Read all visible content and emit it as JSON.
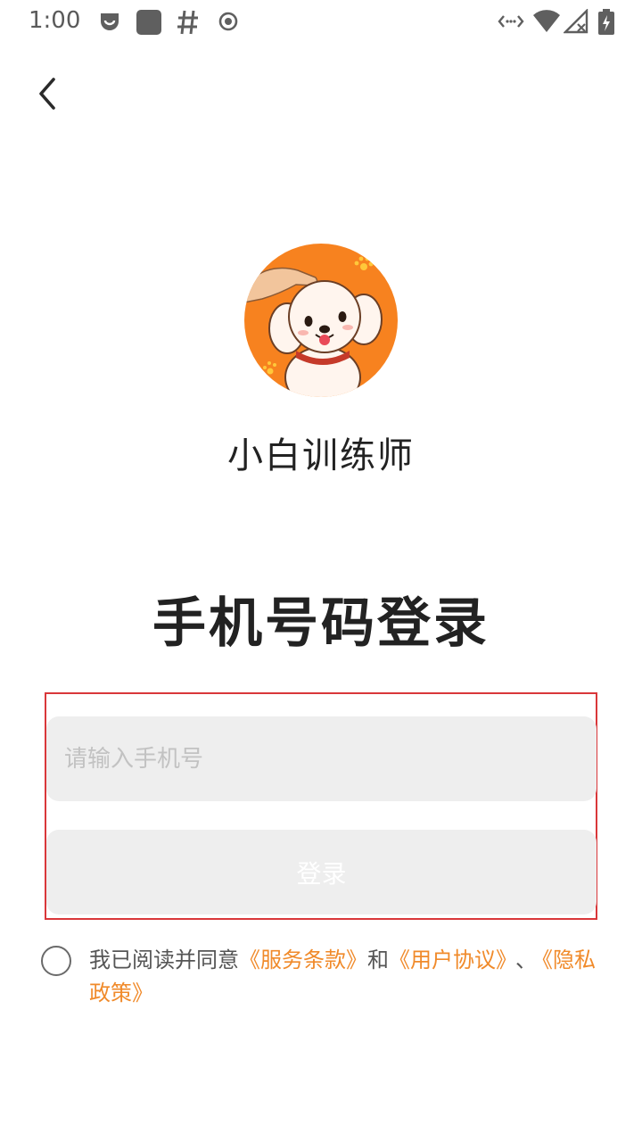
{
  "status_bar": {
    "time": "1:00"
  },
  "app": {
    "name": "小白训练师"
  },
  "login": {
    "title": "手机号码登录",
    "phone_placeholder": "请输入手机号",
    "phone_value": "",
    "login_button": "登录"
  },
  "agreement": {
    "prefix": "我已阅读并同意",
    "terms_link": "《服务条款》",
    "and": "和",
    "user_agreement_link": "《用户协议》",
    "separator": "、",
    "privacy_link": "《隐私政策》"
  },
  "colors": {
    "accent": "#f08a2a",
    "logo_orange": "#f7821f",
    "input_bg": "#eeeeee",
    "highlight_border": "#d9373a"
  },
  "icons": {
    "back": "chevron-left-icon",
    "radio": "radio-unchecked-icon"
  }
}
